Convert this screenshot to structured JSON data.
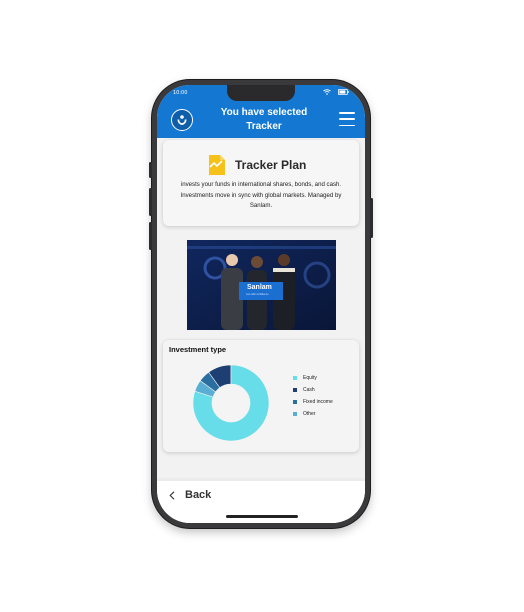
{
  "status_bar": {
    "time": "10:00"
  },
  "header": {
    "title": "You have selected Tracker",
    "logo_icon": "sanlam-hands-logo-icon",
    "menu_icon": "hamburger-menu-icon"
  },
  "plan": {
    "title": "Tracker Plan",
    "description": "invests your funds in international shares, bonds, and cash. Investments move in sync with global markets. Managed by Sanlam.",
    "icon": "chart-document-icon"
  },
  "photo": {
    "banner_text": "Sanlam",
    "banner_sub": "Live with confidence"
  },
  "investment": {
    "title": "Investment type",
    "legend": [
      {
        "label": "Equity",
        "color": "#66dde8"
      },
      {
        "label": "Cash",
        "color": "#1e3f73"
      },
      {
        "label": "Fixed income",
        "color": "#2a6f9f"
      },
      {
        "label": "Other",
        "color": "#5aaed3"
      }
    ]
  },
  "chart_data": {
    "type": "pie",
    "title": "Investment type",
    "categories": [
      "Equity",
      "Cash",
      "Fixed income",
      "Other"
    ],
    "values": [
      80,
      10,
      5,
      5
    ],
    "colors": [
      "#66dde8",
      "#1e3f73",
      "#2a6f9f",
      "#5aaed3"
    ]
  },
  "footer": {
    "back_label": "Back"
  }
}
